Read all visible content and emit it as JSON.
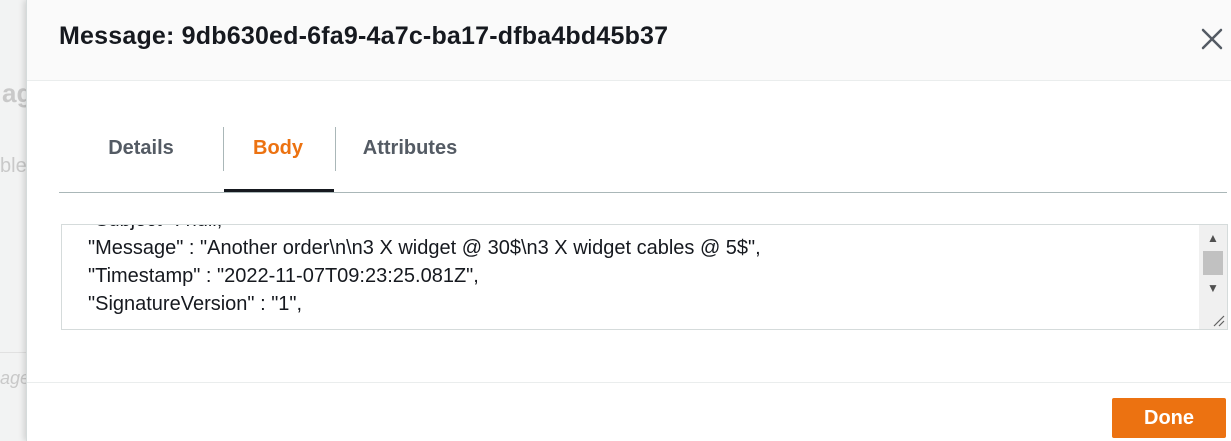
{
  "background": {
    "fragment_title": "ag",
    "fragment_sub": "ble",
    "fragment_bottom": "age"
  },
  "modal": {
    "title": "Message: 9db630ed-6fa9-4a7c-ba17-dfba4bd45b37",
    "close_icon": "close-icon"
  },
  "tabs": [
    {
      "label": "Details",
      "active": false
    },
    {
      "label": "Body",
      "active": true
    },
    {
      "label": "Attributes",
      "active": false
    }
  ],
  "body": {
    "lines": [
      "\"Subject\" : null,",
      "\"Message\" : \"Another order\\n\\n3 X widget @ 30$\\n3 X widget cables @ 5$\",",
      "\"Timestamp\" : \"2022-11-07T09:23:25.081Z\",",
      "\"SignatureVersion\" : \"1\","
    ],
    "scroll_up_icon": "▲",
    "scroll_down_icon": "▼"
  },
  "footer": {
    "done_label": "Done"
  },
  "colors": {
    "accent": "#ec7211",
    "text": "#16191f",
    "muted": "#545b64"
  }
}
